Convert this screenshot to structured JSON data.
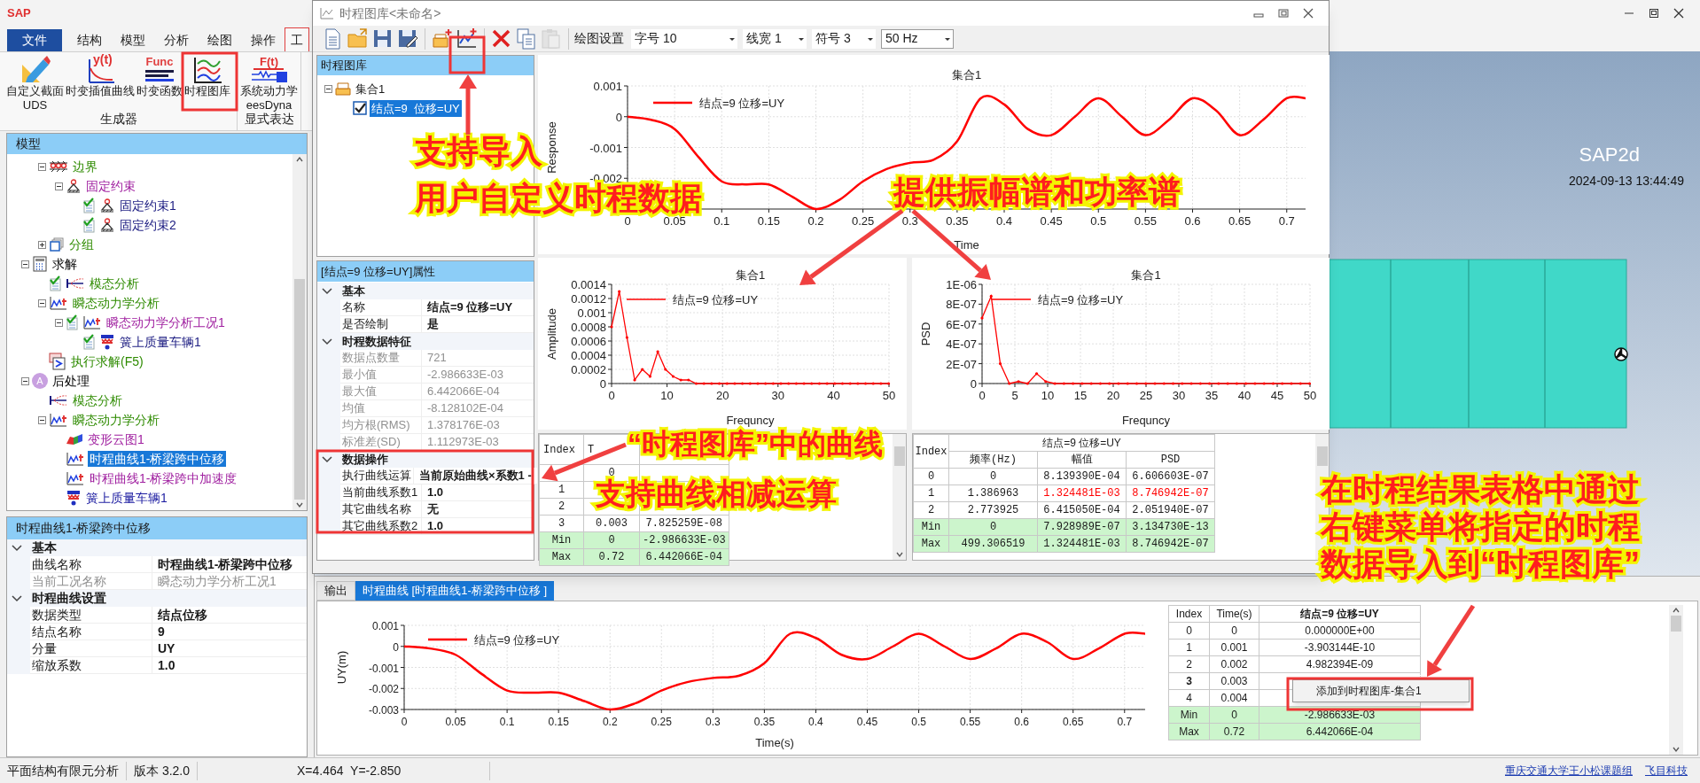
{
  "app": {
    "logo": "SAP",
    "ribbon_tabs": [
      {
        "label": "文件",
        "kind": "file",
        "selected": false
      },
      {
        "label": "结构",
        "kind": "tab",
        "selected": false
      },
      {
        "label": "模型",
        "kind": "tab",
        "selected": false
      },
      {
        "label": "分析",
        "kind": "tab",
        "selected": false
      },
      {
        "label": "绘图",
        "kind": "tab",
        "selected": false
      },
      {
        "label": "操作",
        "kind": "tab",
        "selected": false
      },
      {
        "label": "工",
        "kind": "tab",
        "selected": true
      }
    ],
    "ribbon_groups": [
      {
        "label": "生成器",
        "buttons": [
          {
            "lines": [
              "自定义截面",
              "UDS"
            ],
            "kind": "section"
          },
          {
            "lines": [
              "时变插值曲线"
            ],
            "kind": "interp",
            "icon_text": "y(t)"
          },
          {
            "lines": [
              "时变函数"
            ],
            "kind": "func",
            "icon_text": "Func"
          },
          {
            "lines": [
              "时程图库"
            ],
            "kind": "library"
          }
        ]
      },
      {
        "label": "显式表达",
        "buttons": [
          {
            "lines": [
              "系统动力学",
              "eesDyna"
            ],
            "kind": "dyna",
            "icon_text": "F(t)"
          }
        ]
      }
    ]
  },
  "model_panel": {
    "title": "模型",
    "continued_items": [
      {
        "label": "边界",
        "kind": "boundary",
        "color": "#2e8b00",
        "expanded": true,
        "selected": false,
        "children": [
          {
            "label": "固定约束",
            "kind": "support",
            "color": "#a020a0",
            "expanded": true,
            "selected": false,
            "children": [
              {
                "label": "固定约束1",
                "kind": "support",
                "color": "#1a1a80",
                "checked": true,
                "selected": false
              },
              {
                "label": "固定约束2",
                "kind": "support",
                "color": "#1a1a80",
                "checked": true,
                "selected": false
              }
            ]
          }
        ]
      },
      {
        "label": "分组",
        "kind": "group",
        "color": "#2e8b00",
        "expanded": false,
        "selected": false
      }
    ],
    "items": [
      {
        "label": "求解",
        "kind": "solve",
        "color": "#000000",
        "expanded": true,
        "selected": false,
        "children": [
          {
            "label": "模态分析",
            "kind": "modal",
            "color": "#2e8b00",
            "checked": true,
            "selected": false
          },
          {
            "label": "瞬态动力学分析",
            "kind": "transient",
            "color": "#2e8b00",
            "expanded": true,
            "selected": false,
            "children": [
              {
                "label": "瞬态动力学分析工况1",
                "kind": "transient",
                "color": "#a020a0",
                "checked": true,
                "expanded": true,
                "selected": false,
                "children": [
                  {
                    "label": "簧上质量车辆1",
                    "kind": "vehicle",
                    "color": "#1a1a80",
                    "checked": true,
                    "selected": false
                  }
                ]
              }
            ]
          },
          {
            "label": "执行求解(F5)",
            "kind": "run",
            "color": "#2e8b00",
            "selected": false
          }
        ]
      },
      {
        "label": "后处理",
        "kind": "post",
        "badge": "A",
        "color": "#000000",
        "expanded": true,
        "selected": false,
        "children": [
          {
            "label": "模态分析",
            "kind": "modal",
            "color": "#2e8b00",
            "selected": false
          },
          {
            "label": "瞬态动力学分析",
            "kind": "transient",
            "color": "#2e8b00",
            "expanded": true,
            "selected": false,
            "children": [
              {
                "label": "变形云图1",
                "kind": "contour",
                "color": "#a020a0",
                "selected": false
              },
              {
                "label": "时程曲线1-桥梁跨中位移",
                "kind": "curve",
                "selected": true
              },
              {
                "label": "时程曲线1-桥梁跨中加速度",
                "kind": "curve",
                "color": "#a020a0",
                "selected": false
              },
              {
                "label": "簧上质量车辆1",
                "kind": "vehicle",
                "color": "#1a1aa0",
                "selected": false
              }
            ]
          }
        ]
      }
    ]
  },
  "properties_panel": {
    "title": "时程曲线1-桥梁跨中位移",
    "sections": [
      {
        "title": "基本",
        "rows": [
          {
            "name": "曲线名称",
            "value": "时程曲线1-桥梁跨中位移",
            "disabled": false
          },
          {
            "name": "当前工况名称",
            "value": "瞬态动力学分析工况1",
            "disabled": true
          }
        ]
      },
      {
        "title": "时程曲线设置",
        "rows": [
          {
            "name": "数据类型",
            "value": "结点位移",
            "disabled": false
          },
          {
            "name": "结点名称",
            "value": "9",
            "disabled": false
          },
          {
            "name": "分量",
            "value": "UY",
            "disabled": false
          },
          {
            "name": "缩放系数",
            "value": "1.0",
            "disabled": false
          }
        ]
      }
    ]
  },
  "viewport": {
    "title": "SAP2d",
    "timestamp": "2024-09-13 13:44:49"
  },
  "library_window": {
    "title": "时程图库<未命名>",
    "toolbar": {
      "buttons": [
        {
          "kind": "new",
          "disabled": false
        },
        {
          "kind": "open",
          "disabled": false
        },
        {
          "kind": "save",
          "disabled": false
        },
        {
          "kind": "saveas",
          "disabled": false
        },
        {
          "kind": "addset",
          "disabled": false
        },
        {
          "kind": "import",
          "disabled": false
        },
        {
          "kind": "delete",
          "disabled": false
        },
        {
          "kind": "copy",
          "disabled": false
        },
        {
          "kind": "paste",
          "disabled": true
        }
      ],
      "settings_label": "绘图设置",
      "dropdowns": [
        "字号 10",
        "线宽 1",
        "符号 3",
        "50 Hz"
      ]
    },
    "library_title": "时程图库",
    "library_tree": [
      {
        "label": "集合1",
        "expanded": true,
        "selected": false,
        "children": [
          {
            "label": "结点=9  位移=UY",
            "checked": true,
            "selected": true
          }
        ]
      }
    ],
    "properties_title": "[结点=9 位移=UY]属性",
    "properties": [
      {
        "title": "基本",
        "rows": [
          {
            "name": "名称",
            "value": "结点=9 位移=UY",
            "disabled": false
          },
          {
            "name": "是否绘制",
            "value": "是",
            "disabled": false
          }
        ]
      },
      {
        "title": "时程数据特征",
        "rows": [
          {
            "name": "数据点数量",
            "value": "721",
            "disabled": true
          },
          {
            "name": "最小值",
            "value": "-2.986633E-03",
            "disabled": true
          },
          {
            "name": "最大值",
            "value": "6.442066E-04",
            "disabled": true
          },
          {
            "name": "均值",
            "value": "-8.128102E-04",
            "disabled": true
          },
          {
            "name": "均方根(RMS)",
            "value": "1.378176E-03",
            "disabled": true
          },
          {
            "name": "标准差(SD)",
            "value": "1.112973E-03",
            "disabled": true
          }
        ]
      },
      {
        "title": "数据操作",
        "rows": [
          {
            "name": "执行曲线运算",
            "value": "当前原始曲线×系数1 -",
            "disabled": false
          },
          {
            "name": "当前曲线系数1",
            "value": "1.0",
            "disabled": false
          },
          {
            "name": "其它曲线名称",
            "value": "无",
            "disabled": false
          },
          {
            "name": "其它曲线系数2",
            "value": "1.0",
            "disabled": false
          }
        ]
      }
    ],
    "time_chart": {
      "chart_data": {
        "type": "line",
        "title": "集合1",
        "xlabel": "Time",
        "ylabel": "Response",
        "grid": true,
        "x": [
          0,
          0.025,
          0.05,
          0.075,
          0.1,
          0.125,
          0.15,
          0.175,
          0.2,
          0.225,
          0.25,
          0.275,
          0.3,
          0.325,
          0.35,
          0.375,
          0.4,
          0.425,
          0.45,
          0.475,
          0.5,
          0.525,
          0.55,
          0.575,
          0.6,
          0.625,
          0.65,
          0.675,
          0.7,
          0.72
        ],
        "series": [
          {
            "name": "结点=9  位移=UY",
            "color": "#ff0000",
            "values": [
              0,
              -0.0001,
              -0.0004,
              -0.0013,
              -0.0021,
              -0.0022,
              -0.0022,
              -0.0026,
              -0.003,
              -0.0027,
              -0.0021,
              -0.0017,
              -0.0015,
              -0.0014,
              -0.0008,
              0.0006,
              0.0004,
              -0.0004,
              -0.0006,
              0.0,
              0.0006,
              0.0,
              -0.0006,
              -0.0001,
              0.0006,
              0.0002,
              -0.0006,
              -0.0001,
              0.0006,
              0.0006
            ]
          }
        ],
        "xlim": [
          0,
          0.72
        ],
        "ylim": [
          -0.003,
          0.001
        ],
        "xticks": [
          0,
          0.05,
          0.1,
          0.15,
          0.2,
          0.25,
          0.3,
          0.35,
          0.4,
          0.45,
          0.5,
          0.55,
          0.6,
          0.65,
          0.7
        ],
        "yticks": [
          0.001,
          0,
          -0.001,
          -0.002
        ]
      }
    },
    "amplitude_chart": {
      "chart_data": {
        "type": "line",
        "title": "集合1",
        "xlabel": "Frequncy",
        "ylabel": "Amplitude",
        "grid": true,
        "x": [
          0,
          1.387,
          2.774,
          4.161,
          5.548,
          6.935,
          8.322,
          9.709,
          11.096,
          12.483,
          13.87,
          15.257,
          16.644,
          18.031,
          19.418,
          20.805,
          22.192,
          23.579,
          24.966,
          26.353,
          27.74,
          29.127,
          30.514,
          31.901,
          33.288,
          34.675,
          36.062,
          37.449,
          38.836,
          40.223,
          41.61,
          42.997,
          44.384,
          45.771,
          47.158,
          48.545,
          49.932
        ],
        "series": [
          {
            "name": "结点=9  位移=UY",
            "color": "#ff0000",
            "values": [
              0.0008,
              0.0013,
              0.00065,
              5e-05,
              0.0002,
              0.0001,
              0.00045,
              0.0002,
              0.0001,
              5e-05,
              5e-05,
              0,
              0,
              0,
              0,
              0,
              0,
              0,
              0,
              0,
              0,
              0,
              0,
              0,
              0,
              0,
              0,
              0,
              0,
              0,
              0,
              0,
              0,
              0,
              0,
              0,
              0
            ]
          }
        ],
        "xlim": [
          0,
          50
        ],
        "ylim": [
          0,
          0.0014
        ],
        "xticks": [
          0,
          10,
          20,
          30,
          40,
          50
        ],
        "yticks": [
          0,
          0.0002,
          0.0004,
          0.0006,
          0.0008,
          0.001,
          0.0012,
          0.0014
        ]
      }
    },
    "psd_chart": {
      "chart_data": {
        "type": "line",
        "title": "集合1",
        "xlabel": "Frequncy",
        "ylabel": "PSD",
        "grid": true,
        "x": [
          0,
          1.387,
          2.774,
          4.161,
          5.548,
          6.935,
          8.322,
          9.709,
          11.096,
          12.483,
          13.87,
          15.257,
          16.644,
          18.031,
          19.418,
          20.805,
          22.192,
          23.579,
          24.966,
          26.353,
          27.74,
          29.127,
          30.514,
          31.901,
          33.288,
          34.675,
          36.062,
          37.449,
          38.836,
          40.223,
          41.61,
          42.997,
          44.384,
          45.771,
          47.158,
          48.545,
          49.932
        ],
        "series": [
          {
            "name": "结点=9  位移=UY",
            "color": "#ff0000",
            "values": [
              6.6e-07,
              8.8e-07,
              2e-07,
              0,
              2e-08,
              0,
              1e-07,
              2e-08,
              0,
              0,
              0,
              0,
              0,
              0,
              0,
              0,
              0,
              0,
              0,
              0,
              0,
              0,
              0,
              0,
              0,
              0,
              0,
              0,
              0,
              0,
              0,
              0,
              0,
              0,
              0,
              0,
              0
            ]
          }
        ],
        "xlim": [
          0,
          50
        ],
        "ylim": [
          0,
          1e-06
        ],
        "xticks": [
          0,
          5,
          10,
          15,
          20,
          25,
          30,
          35,
          40,
          45,
          50
        ],
        "yticks": [
          {
            "value": 0,
            "label": "0"
          },
          {
            "value": 2e-07,
            "label": "2E-07"
          },
          {
            "value": 4e-07,
            "label": "4E-07"
          },
          {
            "value": 6e-07,
            "label": "6E-07"
          },
          {
            "value": 8e-07,
            "label": "8E-07"
          },
          {
            "value": 1e-06,
            "label": "1E-06"
          }
        ]
      }
    },
    "time_table": {
      "columns": [
        "Index",
        "T"
      ],
      "rows": [
        {
          "kind": "data",
          "time": "0"
        },
        {
          "kind": "data",
          "index": "1"
        },
        {
          "kind": "data",
          "index": "2"
        },
        {
          "kind": "data",
          "index": "3",
          "time": "0.003",
          "value": "7.825259E-08"
        },
        {
          "kind": "summary",
          "index": "Min",
          "time": "0",
          "value": "-2.986633E-03"
        },
        {
          "kind": "summary",
          "index": "Max",
          "time": "0.72",
          "value": "6.442066E-04"
        }
      ]
    },
    "spectrum_table": {
      "group_header": "结点=9 位移=UY",
      "columns": [
        "Index",
        "频率(Hz)",
        "幅值",
        "PSD"
      ],
      "rows": [
        {
          "kind": "data",
          "peak": false,
          "cells": [
            "0",
            "0",
            "8.139390E-04",
            "6.606603E-07"
          ]
        },
        {
          "kind": "data",
          "peak": true,
          "cells": [
            "1",
            "1.386963",
            "1.324481E-03",
            "8.746942E-07"
          ]
        },
        {
          "kind": "data",
          "peak": false,
          "cells": [
            "2",
            "2.773925",
            "6.415050E-04",
            "2.051940E-07"
          ]
        },
        {
          "kind": "summary",
          "peak": false,
          "cells": [
            "Min",
            "0",
            "7.928989E-07",
            "3.134730E-13"
          ]
        },
        {
          "kind": "summary",
          "peak": false,
          "cells": [
            "Max",
            "499.306519",
            "1.324481E-03",
            "8.746942E-07"
          ]
        }
      ]
    }
  },
  "output_panel": {
    "tabs": [
      {
        "label": "输出",
        "selected": false
      },
      {
        "label": "时程曲线 [时程曲线1-桥梁跨中位移 ]",
        "selected": true
      }
    ],
    "chart": {
      "chart_data": {
        "type": "line",
        "xlabel": "Time(s)",
        "ylabel": "UY(m)",
        "grid": true,
        "x": [
          0,
          0.025,
          0.05,
          0.075,
          0.1,
          0.125,
          0.15,
          0.175,
          0.2,
          0.225,
          0.25,
          0.275,
          0.3,
          0.325,
          0.35,
          0.375,
          0.4,
          0.425,
          0.45,
          0.475,
          0.5,
          0.525,
          0.55,
          0.575,
          0.6,
          0.625,
          0.65,
          0.675,
          0.7,
          0.72
        ],
        "series": [
          {
            "name": "结点=9  位移=UY",
            "color": "#ff0000",
            "values": [
              0,
              -0.0001,
              -0.0004,
              -0.0013,
              -0.0021,
              -0.0022,
              -0.0022,
              -0.0026,
              -0.003,
              -0.0027,
              -0.0021,
              -0.0017,
              -0.0015,
              -0.0014,
              -0.0008,
              0.0006,
              0.0004,
              -0.0004,
              -0.0006,
              0.0,
              0.0006,
              0.0,
              -0.0006,
              -0.0001,
              0.0006,
              0.0002,
              -0.0006,
              -0.0001,
              0.0006,
              0.0006
            ]
          }
        ],
        "xlim": [
          0,
          0.72
        ],
        "ylim": [
          -0.003,
          0.001
        ],
        "xticks": [
          0,
          0.05,
          0.1,
          0.15,
          0.2,
          0.25,
          0.3,
          0.35,
          0.4,
          0.45,
          0.5,
          0.55,
          0.6,
          0.65,
          0.7
        ],
        "yticks": [
          0.001,
          0,
          -0.001,
          -0.002,
          -0.003
        ]
      }
    },
    "table": {
      "columns": [
        "Index",
        "Time(s)",
        "结点=9 位移=UY"
      ],
      "rows": [
        {
          "selected": false,
          "cells": [
            "0",
            "0",
            "0.000000E+00"
          ],
          "kind": "data"
        },
        {
          "selected": false,
          "cells": [
            "1",
            "0.001",
            "-3.903144E-10"
          ],
          "kind": "data"
        },
        {
          "selected": false,
          "cells": [
            "2",
            "0.002",
            "4.982394E-09"
          ],
          "kind": "data"
        },
        {
          "selected": true,
          "cells": [
            "3",
            "0.003"
          ],
          "kind": "data"
        },
        {
          "selected": false,
          "cells": [
            "4",
            "0.004"
          ],
          "kind": "data"
        },
        {
          "selected": false,
          "cells": [
            "Min",
            "0",
            "-2.986633E-03"
          ],
          "kind": "summary"
        },
        {
          "selected": false,
          "cells": [
            "Max",
            "0.72",
            "6.442066E-04"
          ],
          "kind": "summary"
        }
      ]
    },
    "context_menu": [
      "添加到时程图库-集合1"
    ]
  },
  "status_bar": {
    "items": [
      "平面结构有限元分析",
      "版本 3.2.0",
      "X=4.464  Y=-2.850"
    ],
    "links": [
      "重庆交通大学王小松课题组",
      "飞目科技"
    ]
  },
  "annotations": [
    {
      "lines": [
        "支持导入",
        "用户自定义时程数据"
      ]
    },
    {
      "lines": [
        "提供振幅谱和功率谱"
      ]
    },
    {
      "lines": [
        "“时程图库”中的曲线",
        "支持曲线相减运算"
      ]
    },
    {
      "lines": [
        "在时程结果表格中通过",
        "右键菜单将指定的时程",
        "数据导入到“时程图库”"
      ]
    }
  ]
}
